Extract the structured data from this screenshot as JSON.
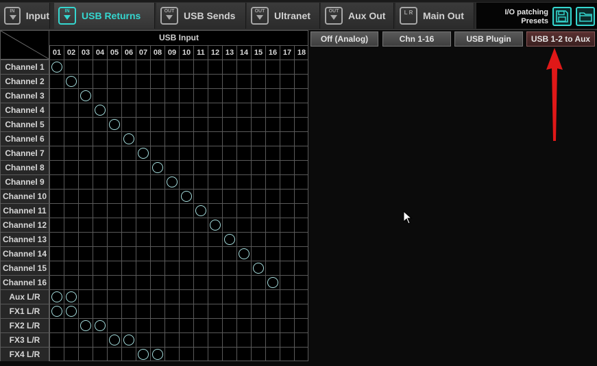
{
  "tabs": [
    {
      "label": "Input",
      "icon": "in-icon",
      "icon_text": "IN",
      "active": false
    },
    {
      "label": "USB Returns",
      "icon": "in-icon",
      "icon_text": "IN",
      "active": true
    },
    {
      "label": "USB Sends",
      "icon": "out-icon",
      "icon_text": "OUT",
      "active": false
    },
    {
      "label": "Ultranet",
      "icon": "out-icon",
      "icon_text": "OUT",
      "active": false
    },
    {
      "label": "Aux Out",
      "icon": "out-icon",
      "icon_text": "OUT",
      "active": false
    },
    {
      "label": "Main Out",
      "icon": "lr-icon",
      "icon_text": "L R",
      "active": false
    }
  ],
  "presets": {
    "line1": "I/O patching",
    "line2": "Presets",
    "save_icon": "save-icon",
    "open_icon": "folder-icon"
  },
  "matrix": {
    "title": "USB Input",
    "columns": [
      "01",
      "02",
      "03",
      "04",
      "05",
      "06",
      "07",
      "08",
      "09",
      "10",
      "11",
      "12",
      "13",
      "14",
      "15",
      "16",
      "17",
      "18"
    ],
    "rows": [
      {
        "label": "Channel 1",
        "patched": [
          1
        ]
      },
      {
        "label": "Channel 2",
        "patched": [
          2
        ]
      },
      {
        "label": "Channel 3",
        "patched": [
          3
        ]
      },
      {
        "label": "Channel 4",
        "patched": [
          4
        ]
      },
      {
        "label": "Channel 5",
        "patched": [
          5
        ]
      },
      {
        "label": "Channel 6",
        "patched": [
          6
        ]
      },
      {
        "label": "Channel 7",
        "patched": [
          7
        ]
      },
      {
        "label": "Channel 8",
        "patched": [
          8
        ]
      },
      {
        "label": "Channel 9",
        "patched": [
          9
        ]
      },
      {
        "label": "Channel 10",
        "patched": [
          10
        ]
      },
      {
        "label": "Channel 11",
        "patched": [
          11
        ]
      },
      {
        "label": "Channel 12",
        "patched": [
          12
        ]
      },
      {
        "label": "Channel 13",
        "patched": [
          13
        ]
      },
      {
        "label": "Channel 14",
        "patched": [
          14
        ]
      },
      {
        "label": "Channel 15",
        "patched": [
          15
        ]
      },
      {
        "label": "Channel 16",
        "patched": [
          16
        ]
      },
      {
        "label": "Aux L/R",
        "patched": [
          1,
          2
        ]
      },
      {
        "label": "FX1 L/R",
        "patched": [
          1,
          2
        ]
      },
      {
        "label": "FX2 L/R",
        "patched": [
          3,
          4
        ]
      },
      {
        "label": "FX3 L/R",
        "patched": [
          5,
          6
        ]
      },
      {
        "label": "FX4 L/R",
        "patched": [
          7,
          8
        ]
      }
    ]
  },
  "routing_buttons": [
    {
      "label": "Off (Analog)",
      "selected": false
    },
    {
      "label": "Chn 1-16",
      "selected": false
    },
    {
      "label": "USB Plugin",
      "selected": false
    },
    {
      "label": "USB 1-2 to Aux",
      "selected": true
    }
  ],
  "colors": {
    "accent": "#35d7d0",
    "ring": "#a6dede",
    "arrow": "#e01818",
    "selected_button": "#5a3030"
  }
}
